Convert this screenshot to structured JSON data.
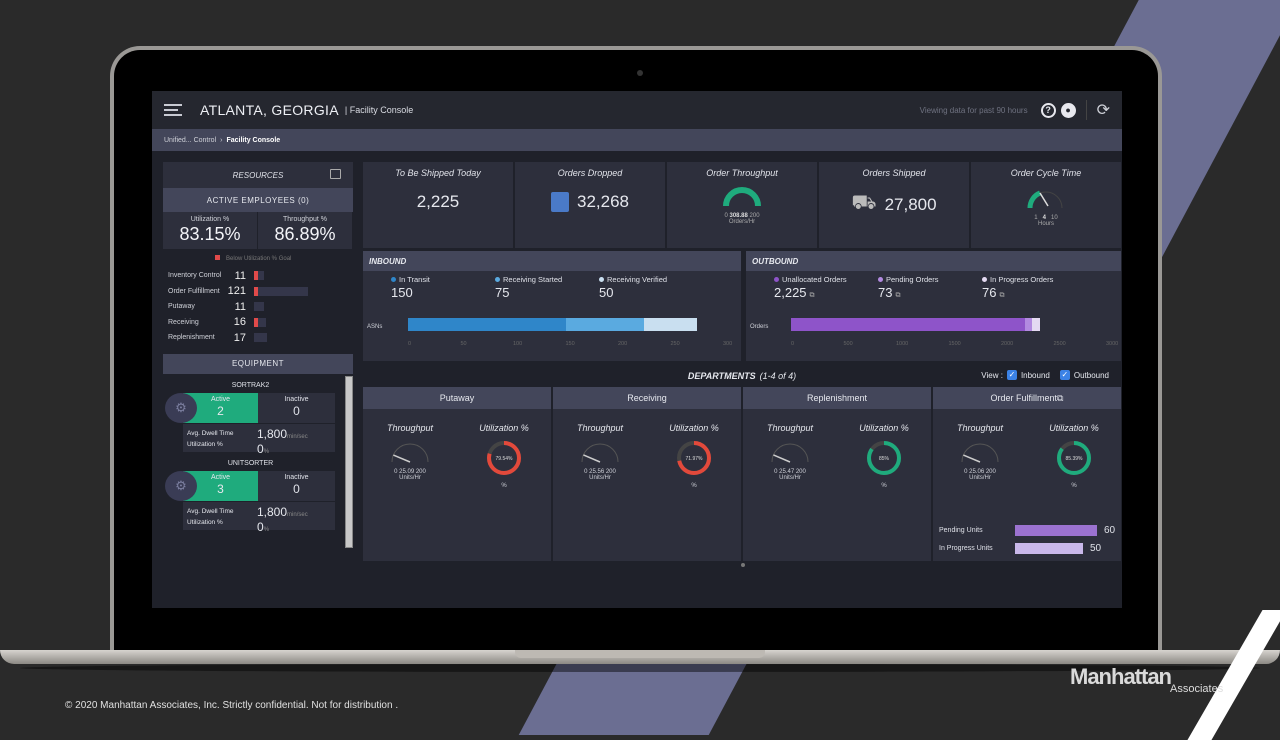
{
  "header": {
    "location": "ATLANTA, GEORGIA",
    "app": "| Facility Console",
    "viewing": "Viewing data for past 90 hours",
    "help_icon": "?",
    "refresh_icon": "⟳"
  },
  "breadcrumb": {
    "parent": "Unified... Control",
    "sep": "›",
    "current": "Facility Console"
  },
  "resources": {
    "title": "RESOURCES",
    "active_employees": "ACTIVE EMPLOYEES (0)",
    "utilization_label": "Utilization %",
    "utilization": "83.15%",
    "throughput_label": "Throughput %",
    "throughput": "86.89%",
    "legend": "Below Utilization % Goal",
    "departments": [
      {
        "name": "Inventory Control",
        "count": "11",
        "share": 0.09,
        "below": true
      },
      {
        "name": "Order Fulfillment",
        "count": "121",
        "share": 1.0,
        "below": true
      },
      {
        "name": "Putaway",
        "count": "11",
        "share": 0.09,
        "below": false
      },
      {
        "name": "Receiving",
        "count": "16",
        "share": 0.13,
        "below": true
      },
      {
        "name": "Replenishment",
        "count": "17",
        "share": 0.14,
        "below": false
      }
    ]
  },
  "equipment": {
    "title": "EQUIPMENT",
    "items": [
      {
        "name": "SORTRAK2",
        "active_label": "Active",
        "active": "2",
        "inactive_label": "Inactive",
        "inactive": "0",
        "dwell_label": "Avg. Dwell Time",
        "dwell": "1,800",
        "dwell_unit": "min/sec",
        "util_label": "Utilization %",
        "util": "0",
        "util_unit": "%"
      },
      {
        "name": "UNITSORTER",
        "active_label": "Active",
        "active": "3",
        "inactive_label": "Inactive",
        "inactive": "0",
        "dwell_label": "Avg. Dwell Time",
        "dwell": "1,800",
        "dwell_unit": "min/sec",
        "util_label": "Utilization %",
        "util": "0",
        "util_unit": "%"
      }
    ]
  },
  "kpis": {
    "shipped_today": {
      "title": "To Be Shipped Today",
      "value": "2,225"
    },
    "orders_dropped": {
      "title": "Orders Dropped",
      "value": "32,268"
    },
    "order_throughput": {
      "title": "Order Throughput",
      "min": "0",
      "value": "308.88",
      "max": "200",
      "unit": "Orders/Hr"
    },
    "orders_shipped": {
      "title": "Orders Shipped",
      "value": "27,800"
    },
    "cycle_time": {
      "title": "Order Cycle Time",
      "min": "1",
      "value": "4",
      "max": "10",
      "unit": "Hours"
    }
  },
  "inbound": {
    "title": "INBOUND",
    "bar_label": "ASNs",
    "stats": [
      {
        "label": "In Transit",
        "value": "150",
        "num": 150,
        "color": "#2f86c9"
      },
      {
        "label": "Receiving Started",
        "value": "75",
        "num": 75,
        "color": "#5aaae0"
      },
      {
        "label": "Receiving Verified",
        "value": "50",
        "num": 50,
        "color": "#c9dff0"
      }
    ],
    "axis": [
      "0",
      "50",
      "100",
      "150",
      "200",
      "250",
      "300"
    ],
    "axis_max": 300
  },
  "outbound": {
    "title": "OUTBOUND",
    "bar_label": "Orders",
    "stats": [
      {
        "label": "Unallocated Orders",
        "value": "2,225",
        "num": 2225,
        "color": "#8e54c9"
      },
      {
        "label": "Pending Orders",
        "value": "73",
        "num": 73,
        "color": "#b28ae0"
      },
      {
        "label": "In Progress Orders",
        "value": "76",
        "num": 76,
        "color": "#e4daf2"
      }
    ],
    "axis": [
      "0",
      "500",
      "1000",
      "1500",
      "2000",
      "2500",
      "3000"
    ],
    "axis_max": 3000
  },
  "departments": {
    "title": "DEPARTMENTS",
    "count": "(1-4 of 4)",
    "view_label": "View :",
    "inbound_label": "Inbound",
    "outbound_label": "Outbound",
    "throughput_label": "Throughput",
    "util_label": "Utilization %",
    "units": "Units/Hr",
    "pct": "%",
    "gmin": "0",
    "gmax": "200",
    "items": [
      {
        "name": "Putaway",
        "throughput": "25.09",
        "util": "79.54%",
        "util_frac": 0.7954,
        "color": "#e2493b"
      },
      {
        "name": "Receiving",
        "throughput": "25.56",
        "util": "71.97%",
        "util_frac": 0.7197,
        "color": "#e2493b"
      },
      {
        "name": "Replenishment",
        "throughput": "25.47",
        "util": "85%",
        "util_frac": 0.85,
        "color": "#1fab7d"
      },
      {
        "name": "Order Fulfillment",
        "throughput": "25.06",
        "util": "85.39%",
        "util_frac": 0.8539,
        "color": "#1fab7d"
      }
    ],
    "pending_label": "Pending Units",
    "pending": "60",
    "inprog_label": "In Progress Units",
    "inprog": "50"
  },
  "footer": {
    "copyright": "© 2020 Manhattan Associates, Inc. Strictly confidential. Not for distribution .",
    "brand": "Manhattan",
    "brand_sub": "Associates"
  }
}
